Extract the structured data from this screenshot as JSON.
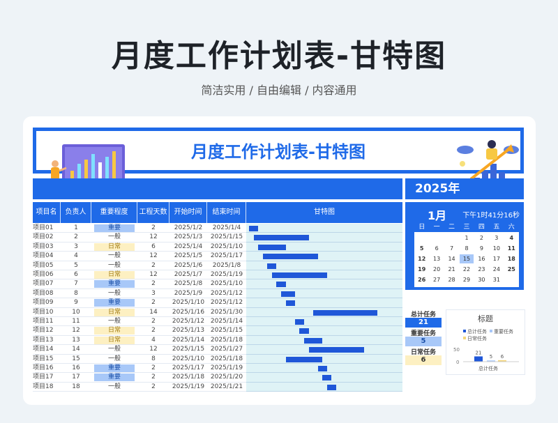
{
  "hero": {
    "title": "月度工作计划表-甘特图",
    "subtitle": "简洁实用 / 自由编辑 / 内容通用"
  },
  "sheet": {
    "title": "月度工作计划表-甘特图",
    "year": "2025年",
    "columns": [
      "项目名称",
      "负责人",
      "重要程度",
      "工程天数",
      "开始时间",
      "结束时间",
      "甘特图"
    ],
    "rows": [
      {
        "name": "项目01",
        "owner": "1",
        "importance": "重要",
        "level": 1,
        "days": "2",
        "start": "2025/1/2",
        "end": "2025/1/4",
        "bs": 1,
        "bd": 2
      },
      {
        "name": "项目02",
        "owner": "2",
        "importance": "一般",
        "level": 2,
        "days": "12",
        "start": "2025/1/3",
        "end": "2025/1/15",
        "bs": 2,
        "bd": 12
      },
      {
        "name": "项目03",
        "owner": "3",
        "importance": "日常",
        "level": 3,
        "days": "6",
        "start": "2025/1/4",
        "end": "2025/1/10",
        "bs": 3,
        "bd": 6
      },
      {
        "name": "项目04",
        "owner": "4",
        "importance": "一般",
        "level": 2,
        "days": "12",
        "start": "2025/1/5",
        "end": "2025/1/17",
        "bs": 4,
        "bd": 12
      },
      {
        "name": "项目05",
        "owner": "5",
        "importance": "一般",
        "level": 2,
        "days": "2",
        "start": "2025/1/6",
        "end": "2025/1/8",
        "bs": 5,
        "bd": 2
      },
      {
        "name": "项目06",
        "owner": "6",
        "importance": "日常",
        "level": 3,
        "days": "12",
        "start": "2025/1/7",
        "end": "2025/1/19",
        "bs": 6,
        "bd": 12
      },
      {
        "name": "项目07",
        "owner": "7",
        "importance": "重要",
        "level": 1,
        "days": "2",
        "start": "2025/1/8",
        "end": "2025/1/10",
        "bs": 7,
        "bd": 2
      },
      {
        "name": "项目08",
        "owner": "8",
        "importance": "一般",
        "level": 2,
        "days": "3",
        "start": "2025/1/9",
        "end": "2025/1/12",
        "bs": 8,
        "bd": 3
      },
      {
        "name": "项目09",
        "owner": "9",
        "importance": "重要",
        "level": 1,
        "days": "2",
        "start": "2025/1/10",
        "end": "2025/1/12",
        "bs": 9,
        "bd": 2
      },
      {
        "name": "项目10",
        "owner": "10",
        "importance": "日常",
        "level": 3,
        "days": "14",
        "start": "2025/1/16",
        "end": "2025/1/30",
        "bs": 15,
        "bd": 14
      },
      {
        "name": "项目11",
        "owner": "11",
        "importance": "一般",
        "level": 2,
        "days": "2",
        "start": "2025/1/12",
        "end": "2025/1/14",
        "bs": 11,
        "bd": 2
      },
      {
        "name": "项目12",
        "owner": "12",
        "importance": "日常",
        "level": 3,
        "days": "2",
        "start": "2025/1/13",
        "end": "2025/1/15",
        "bs": 12,
        "bd": 2
      },
      {
        "name": "项目13",
        "owner": "13",
        "importance": "日常",
        "level": 3,
        "days": "4",
        "start": "2025/1/14",
        "end": "2025/1/18",
        "bs": 13,
        "bd": 4
      },
      {
        "name": "项目14",
        "owner": "14",
        "importance": "一般",
        "level": 2,
        "days": "12",
        "start": "2025/1/15",
        "end": "2025/1/27",
        "bs": 14,
        "bd": 12
      },
      {
        "name": "项目15",
        "owner": "15",
        "importance": "一般",
        "level": 2,
        "days": "8",
        "start": "2025/1/10",
        "end": "2025/1/18",
        "bs": 9,
        "bd": 8
      },
      {
        "name": "项目16",
        "owner": "16",
        "importance": "重要",
        "level": 1,
        "days": "2",
        "start": "2025/1/17",
        "end": "2025/1/19",
        "bs": 16,
        "bd": 2
      },
      {
        "name": "项目17",
        "owner": "17",
        "importance": "重要",
        "level": 1,
        "days": "2",
        "start": "2025/1/18",
        "end": "2025/1/20",
        "bs": 17,
        "bd": 2
      },
      {
        "name": "项目18",
        "owner": "18",
        "importance": "一般",
        "level": 2,
        "days": "2",
        "start": "2025/1/19",
        "end": "2025/1/21",
        "bs": 18,
        "bd": 2
      }
    ],
    "gantt_total_days": 31
  },
  "calendar": {
    "month": "1月",
    "time": "下午1时41分16秒",
    "weekdays": [
      "日",
      "一",
      "二",
      "三",
      "四",
      "五",
      "六"
    ],
    "weeks": [
      [
        "",
        "",
        "",
        "1",
        "2",
        "3",
        "4"
      ],
      [
        "5",
        "6",
        "7",
        "8",
        "9",
        "10",
        "11"
      ],
      [
        "12",
        "13",
        "14",
        "15",
        "16",
        "17",
        "18"
      ],
      [
        "19",
        "20",
        "21",
        "22",
        "23",
        "24",
        "25"
      ],
      [
        "26",
        "27",
        "28",
        "29",
        "30",
        "31",
        ""
      ]
    ],
    "today": "15"
  },
  "stats": [
    {
      "label": "总计任务",
      "value": "21",
      "color": "#1f6ae8",
      "text": "#ffffff"
    },
    {
      "label": "重要任务",
      "value": "5",
      "color": "#a8c8f8",
      "text": "#1a4fa8"
    },
    {
      "label": "日常任务",
      "value": "6",
      "color": "#fdf0c2",
      "text": "#333333"
    }
  ],
  "mini_chart": {
    "title": "标题",
    "legend": [
      "总计任务",
      "重要任务",
      "日常任务"
    ],
    "axis_ticks": [
      "50",
      "0"
    ],
    "category": "总计任务"
  },
  "chart_data": {
    "type": "bar",
    "categories": [
      "总计任务"
    ],
    "series": [
      {
        "name": "总计任务",
        "values": [
          21
        ]
      },
      {
        "name": "重要任务",
        "values": [
          5
        ]
      },
      {
        "name": "日常任务",
        "values": [
          6
        ]
      }
    ],
    "title": "标题",
    "ylim": [
      0,
      50
    ]
  },
  "colors": {
    "primary": "#1f6ae8",
    "important": "#a8c8f8",
    "daily": "#fdf0c2",
    "bar": "#1f57d8"
  }
}
